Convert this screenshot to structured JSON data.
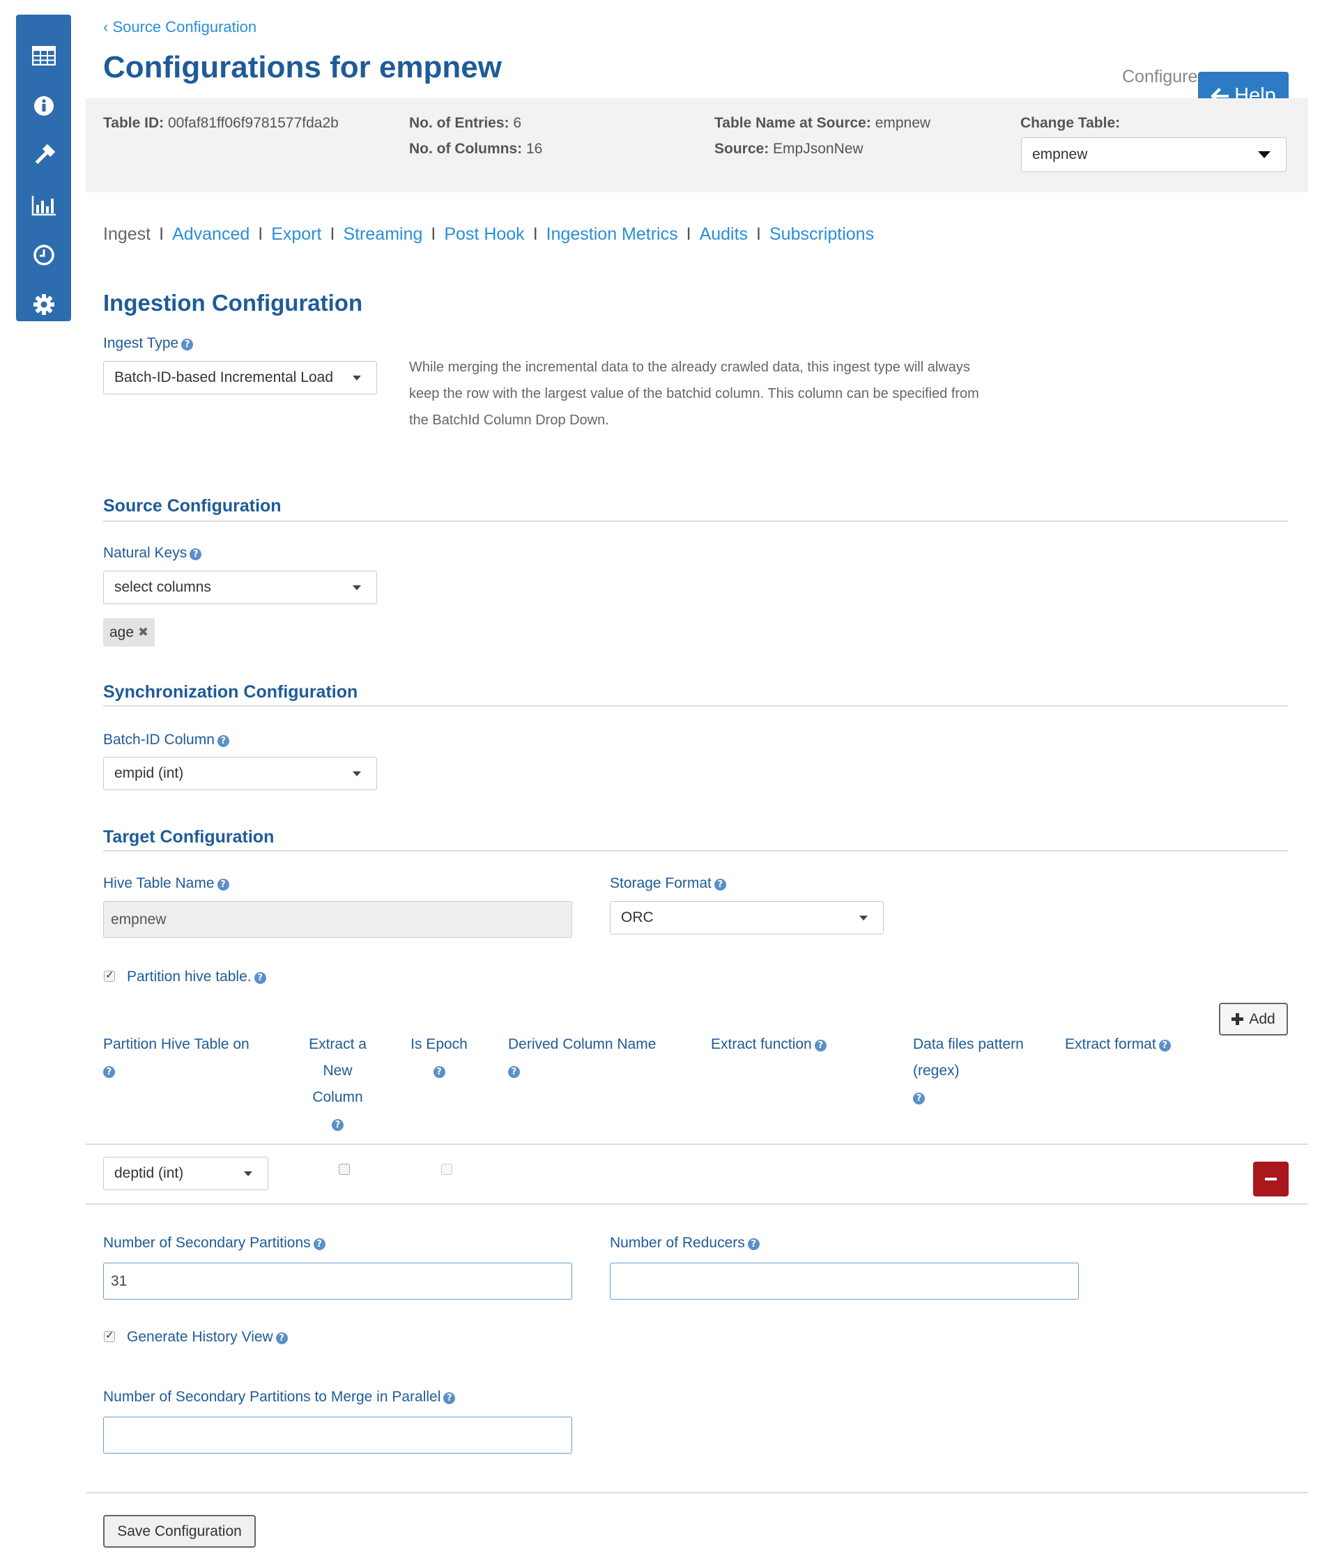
{
  "sidebar": {
    "items": [
      {
        "icon": "table-icon"
      },
      {
        "icon": "info-icon"
      },
      {
        "icon": "gavel-icon"
      },
      {
        "icon": "bar-chart-icon"
      },
      {
        "icon": "clock-icon"
      },
      {
        "icon": "gear-icon"
      }
    ]
  },
  "header": {
    "breadcrumb": "‹ Source Configuration",
    "title": "Configurations for empnew",
    "config_hint": "Configure",
    "help_label": "Help"
  },
  "table_info": {
    "table_id_label": "Table ID:",
    "table_id": "00faf81ff06f9781577fda2b",
    "entries_label": "No. of Entries:",
    "entries": "6",
    "columns_label": "No. of Columns:",
    "columns": "16",
    "table_name_label": "Table Name at Source:",
    "table_name": "empnew",
    "source_label": "Source:",
    "source": "EmpJsonNew",
    "change_table_label": "Change Table:",
    "change_table_value": "empnew"
  },
  "tabs": [
    "Ingest",
    "Advanced",
    "Export",
    "Streaming",
    "Post Hook",
    "Ingestion Metrics",
    "Audits",
    "Subscriptions"
  ],
  "tab_separator": "I",
  "ingestion": {
    "heading": "Ingestion Configuration",
    "ingest_type_label": "Ingest Type",
    "ingest_type_value": "Batch-ID-based Incremental Load",
    "description": "While merging the incremental data to the already crawled data, this ingest type will always keep the row with the largest value of the batchid column. This column can be specified from the BatchId Column Drop Down."
  },
  "source_config": {
    "heading": "Source Configuration",
    "natural_keys_label": "Natural Keys",
    "natural_keys_placeholder": "select columns",
    "selected_keys": [
      "age"
    ]
  },
  "sync_config": {
    "heading": "Synchronization Configuration",
    "batch_id_label": "Batch-ID Column",
    "batch_id_value": "empid (int)"
  },
  "target_config": {
    "heading": "Target Configuration",
    "hive_table_label": "Hive Table Name",
    "hive_table_value": "empnew",
    "storage_format_label": "Storage Format",
    "storage_format_value": "ORC",
    "partition_label": "Partition hive table.",
    "add_label": "Add",
    "columns": {
      "partition_on": "Partition Hive Table on",
      "extract_new": "Extract a New Column",
      "is_epoch": "Is Epoch",
      "derived_name": "Derived Column Name",
      "extract_function": "Extract function",
      "data_files_pattern": "Data files pattern (regex)",
      "extract_format": "Extract format"
    },
    "partition_row": {
      "column": "deptid (int)"
    },
    "secondary_partitions_label": "Number of Secondary Partitions",
    "secondary_partitions_value": "31",
    "reducers_label": "Number of Reducers",
    "reducers_value": "",
    "history_view_label": "Generate History View",
    "merge_parallel_label": "Number of Secondary Partitions to Merge in Parallel",
    "merge_parallel_value": ""
  },
  "actions": {
    "save_label": "Save Configuration"
  },
  "colors": {
    "sidebar": "#2d6cae",
    "heading": "#1f5b98",
    "link": "#2a8ed8",
    "help_button": "#2d7bc4",
    "remove_button": "#a8181d"
  }
}
